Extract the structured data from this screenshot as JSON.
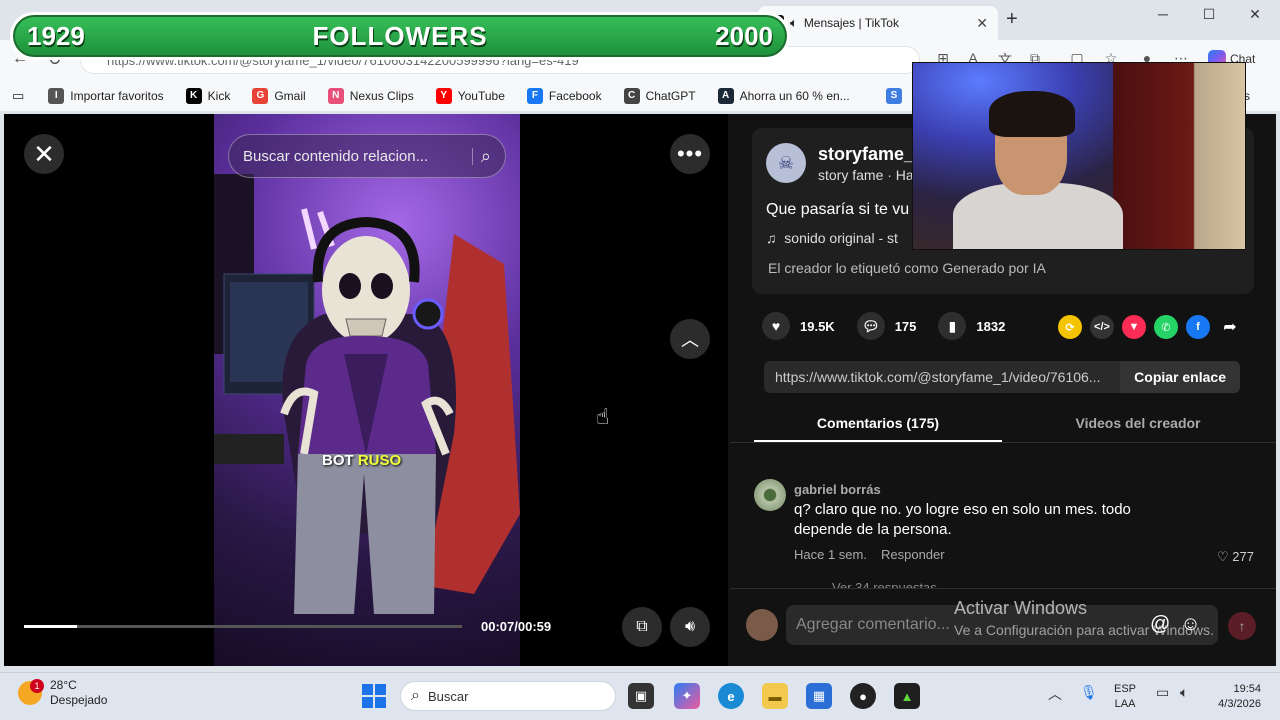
{
  "banner": {
    "left": "1929",
    "center": "FOLLOWERS",
    "right": "2000"
  },
  "browser": {
    "tab_title": "Mensajes | TikTok",
    "url": "https://www.tiktok.com/@storyfame_1/video/7610603142200599996?lang=es-419",
    "chat_label": "Chat",
    "favorites": [
      {
        "label": "Importar favoritos",
        "icon": "import-icon",
        "color": "#555555"
      },
      {
        "label": "Kick",
        "icon": "kick-icon",
        "color": "#000000"
      },
      {
        "label": "Gmail",
        "icon": "gmail-icon",
        "color": "#ea4335"
      },
      {
        "label": "Nexus Clips",
        "icon": "nexus-icon",
        "color": "#e8507a"
      },
      {
        "label": "YouTube",
        "icon": "youtube-icon",
        "color": "#ff0000"
      },
      {
        "label": "Facebook",
        "icon": "facebook-icon",
        "color": "#1877f2"
      },
      {
        "label": "ChatGPT",
        "icon": "chatgpt-icon",
        "color": "#444444"
      },
      {
        "label": "Ahorra un 60 % en...",
        "icon": "steam-icon",
        "color": "#1b2838"
      }
    ],
    "fav_overflow": "tos"
  },
  "player": {
    "search_placeholder": "Buscar contenido relacion...",
    "caption_a": "BOT",
    "caption_b": "RUSO",
    "time": "00:07/00:59",
    "progress": 0.12
  },
  "post": {
    "username": "storyfame_",
    "nickname": "story fame · Ha",
    "description": "Que pasaría si te vu",
    "music": "sonido original - st",
    "ai_label": "El creador lo etiquetó como Generado por IA",
    "likes": "19.5K",
    "comments": "175",
    "saves": "1832",
    "link": "https://www.tiktok.com/@storyfame_1/video/76106...",
    "copy_label": "Copiar enlace"
  },
  "tabs": {
    "comments": "Comentarios (175)",
    "videos": "Videos del creador"
  },
  "comment": {
    "author": "gabriel borrás",
    "text": "q? claro que no. yo logre eso en solo un mes. todo depende de la persona.",
    "time": "Hace 1 sem.",
    "reply": "Responder",
    "likes": "277",
    "more": "Ver 34 respuestas"
  },
  "composer": {
    "placeholder": "Agregar comentario..."
  },
  "watermark": {
    "line1": "Activar Windows",
    "line2": "Ve a Configuración para activar Windows."
  },
  "taskbar": {
    "temp": "28°C",
    "weather": "Despejado",
    "weather_badge": "1",
    "search": "Buscar",
    "lang1": "ESP",
    "lang2": "LAA",
    "time": "19:54",
    "date": "4/3/2026"
  }
}
